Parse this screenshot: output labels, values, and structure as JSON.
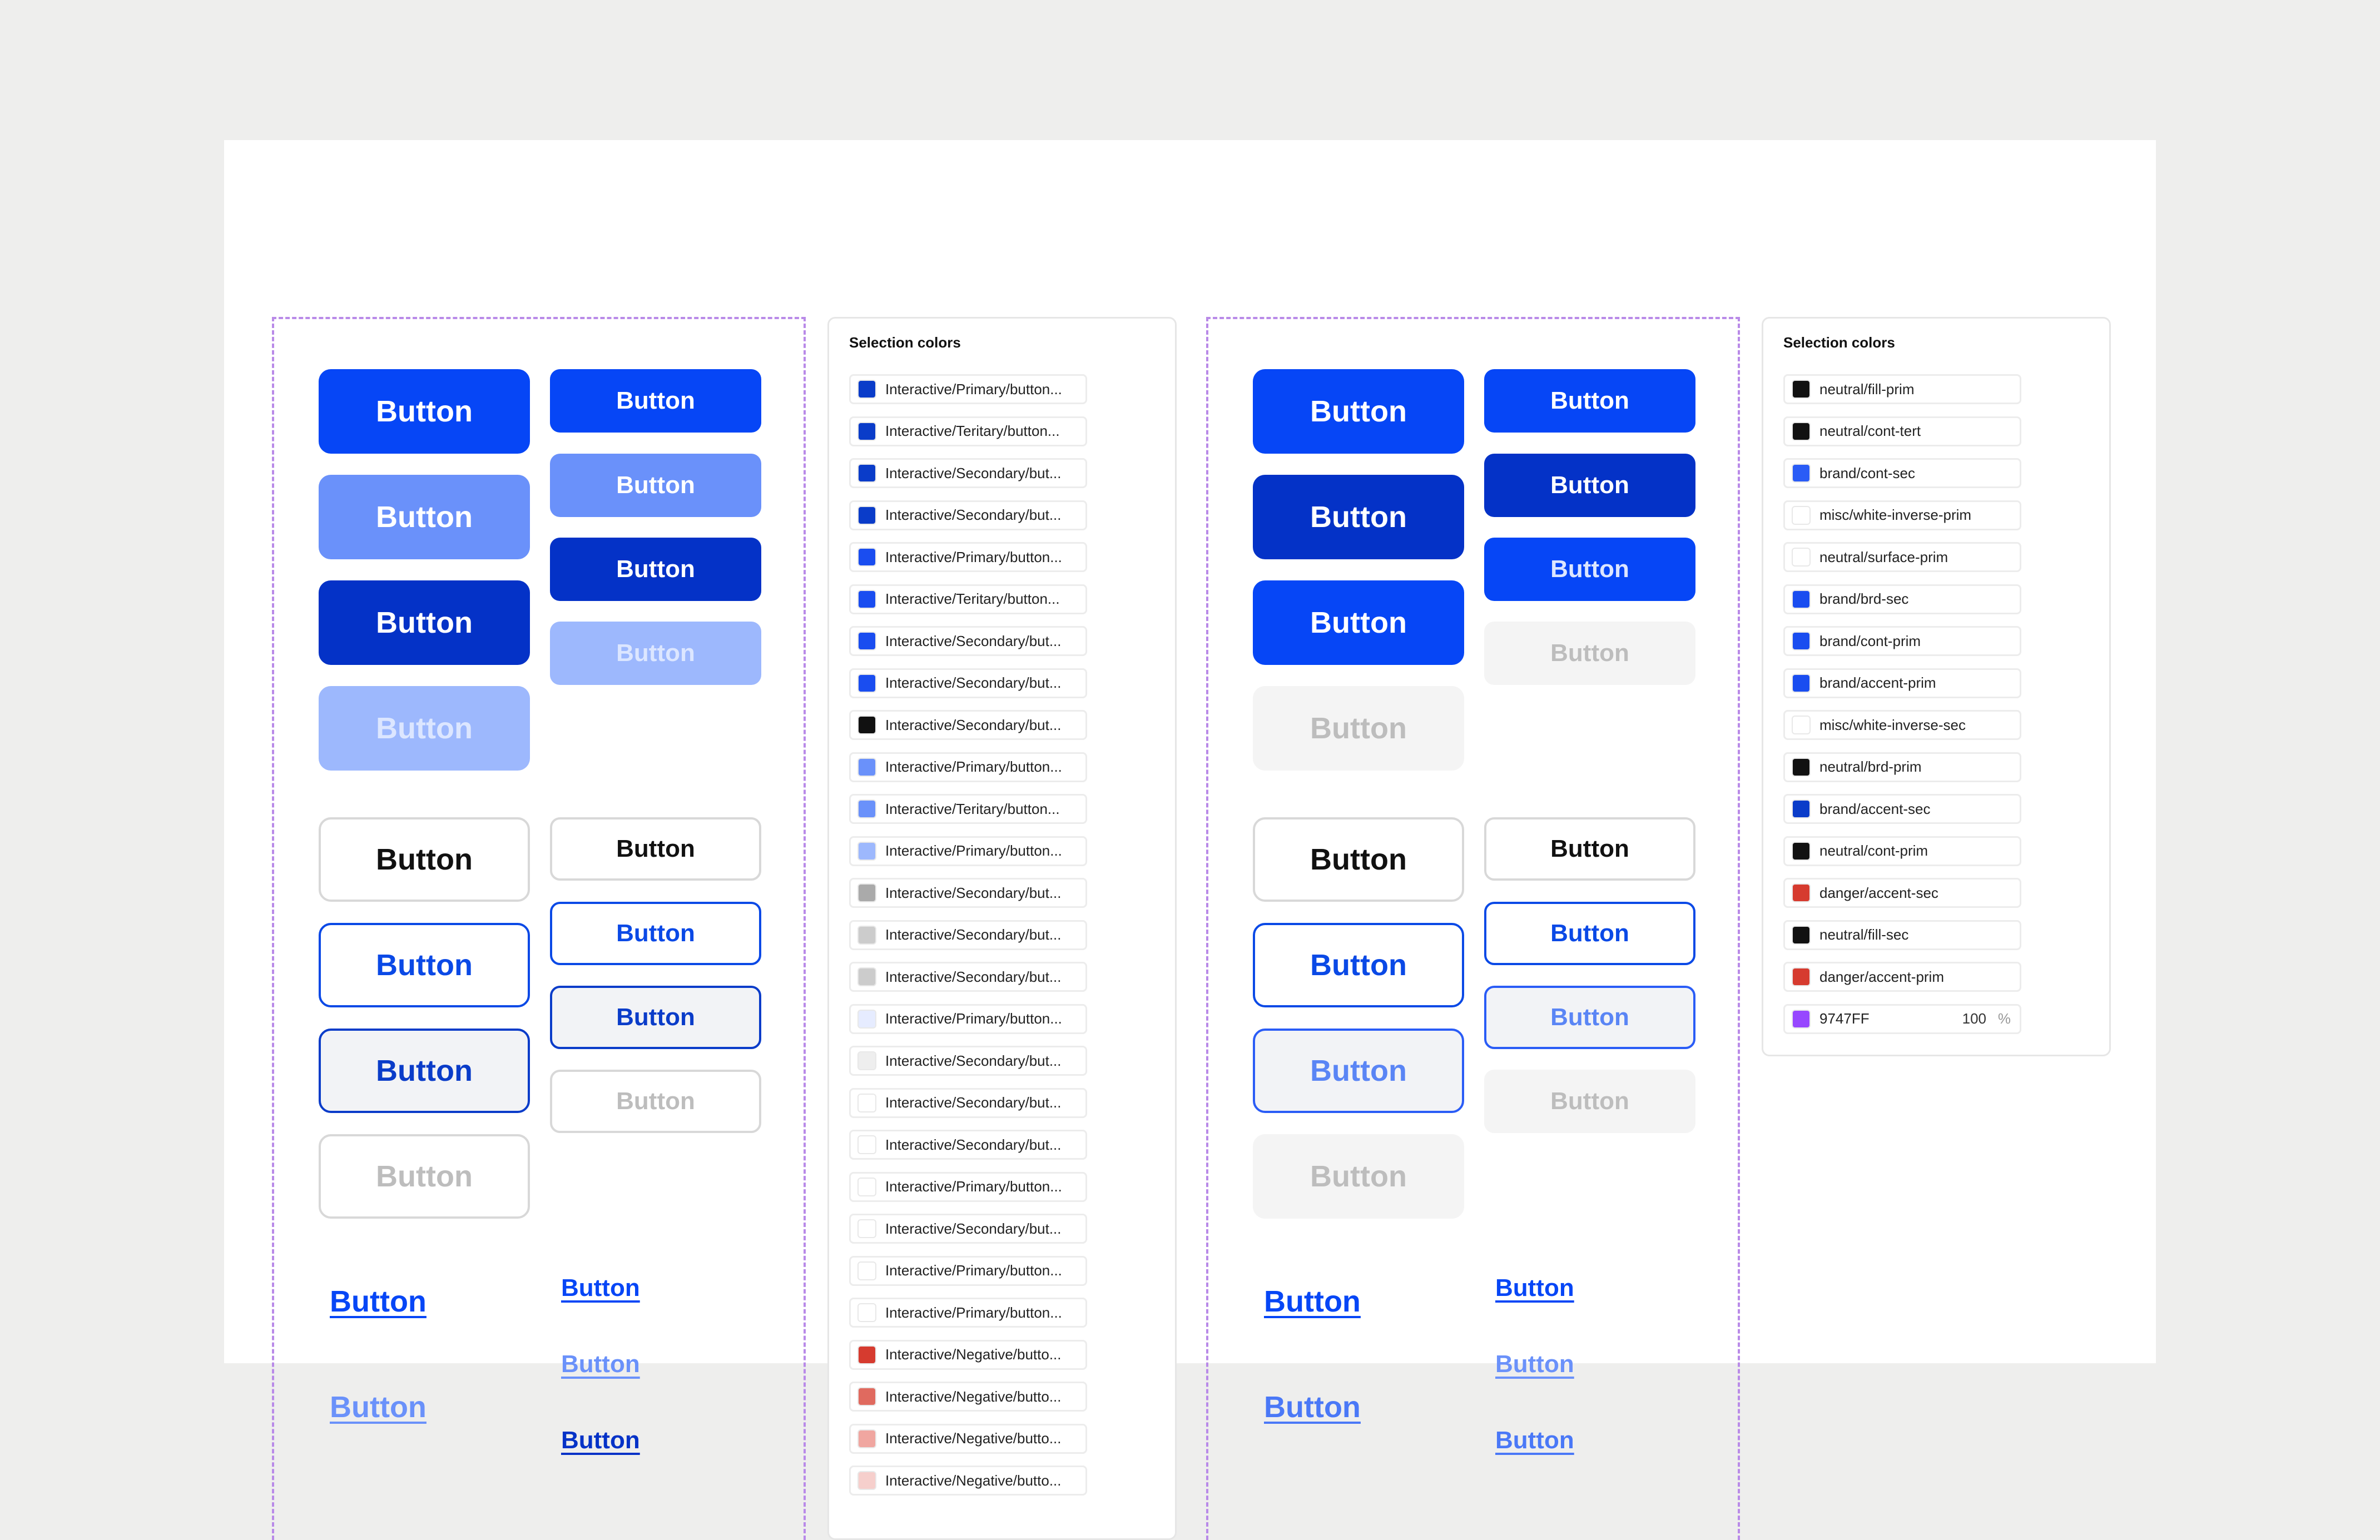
{
  "button_label": "Button",
  "selection_colors_title": "Selection colors",
  "colors": {
    "primary": "#0646f6",
    "light": "#6a91fa",
    "dark": "#0432c7",
    "faded": "#9db8fd",
    "white": "#ffffff",
    "outline_blue": "#0a49e6",
    "pale_fill": "#f2f3f6",
    "muted_fill": "#f4f4f4",
    "muted_text": "#bdbdbd",
    "dark_text": "#111111",
    "light_border": "#d8d8d8"
  },
  "left_panel": {
    "title": "Selection colors",
    "items": [
      {
        "label": "Interactive/Primary/button...",
        "color": "#0a3cc9"
      },
      {
        "label": "Interactive/Teritary/button...",
        "color": "#0a3cc9"
      },
      {
        "label": "Interactive/Secondary/but...",
        "color": "#0a3cc9"
      },
      {
        "label": "Interactive/Secondary/but...",
        "color": "#0a3cc9"
      },
      {
        "label": "Interactive/Primary/button...",
        "color": "#1a4df0"
      },
      {
        "label": "Interactive/Teritary/button...",
        "color": "#1a4df0"
      },
      {
        "label": "Interactive/Secondary/but...",
        "color": "#1a4df0"
      },
      {
        "label": "Interactive/Secondary/but...",
        "color": "#1a4df0"
      },
      {
        "label": "Interactive/Secondary/but...",
        "color": "#111111"
      },
      {
        "label": "Interactive/Primary/button...",
        "color": "#6a91fa"
      },
      {
        "label": "Interactive/Teritary/button...",
        "color": "#6a91fa"
      },
      {
        "label": "Interactive/Primary/button...",
        "color": "#9db8fd"
      },
      {
        "label": "Interactive/Secondary/but...",
        "color": "#aaaaaa"
      },
      {
        "label": "Interactive/Secondary/but...",
        "color": "#cccccc"
      },
      {
        "label": "Interactive/Secondary/but...",
        "color": "#cccccc"
      },
      {
        "label": "Interactive/Primary/button...",
        "color": "#e6ecff"
      },
      {
        "label": "Interactive/Secondary/but...",
        "color": "#eeeeee"
      },
      {
        "label": "Interactive/Secondary/but...",
        "color": "#ffffff"
      },
      {
        "label": "Interactive/Secondary/but...",
        "color": "#ffffff"
      },
      {
        "label": "Interactive/Primary/button...",
        "color": "#ffffff"
      },
      {
        "label": "Interactive/Secondary/but...",
        "color": "#ffffff"
      },
      {
        "label": "Interactive/Primary/button...",
        "color": "#ffffff"
      },
      {
        "label": "Interactive/Primary/button...",
        "color": "#ffffff"
      },
      {
        "label": "Interactive/Negative/butto...",
        "color": "#d63b2f"
      },
      {
        "label": "Interactive/Negative/butto...",
        "color": "#e06a5f"
      },
      {
        "label": "Interactive/Negative/butto...",
        "color": "#f0a6a0"
      },
      {
        "label": "Interactive/Negative/butto...",
        "color": "#f6cfcc"
      }
    ]
  },
  "right_panel": {
    "title": "Selection colors",
    "items": [
      {
        "label": "neutral/fill-prim",
        "color": "#111111"
      },
      {
        "label": "neutral/cont-tert",
        "color": "#111111"
      },
      {
        "label": "brand/cont-sec",
        "color": "#2a5cf6"
      },
      {
        "label": "misc/white-inverse-prim",
        "color": "#ffffff"
      },
      {
        "label": "neutral/surface-prim",
        "color": "#ffffff"
      },
      {
        "label": "brand/brd-sec",
        "color": "#1a4df0"
      },
      {
        "label": "brand/cont-prim",
        "color": "#1a4df0"
      },
      {
        "label": "brand/accent-prim",
        "color": "#1a4df0"
      },
      {
        "label": "misc/white-inverse-sec",
        "color": "#ffffff"
      },
      {
        "label": "neutral/brd-prim",
        "color": "#111111"
      },
      {
        "label": "brand/accent-sec",
        "color": "#0a3cc9"
      },
      {
        "label": "neutral/cont-prim",
        "color": "#111111"
      },
      {
        "label": "danger/accent-sec",
        "color": "#d63b2f"
      },
      {
        "label": "neutral/fill-sec",
        "color": "#111111"
      },
      {
        "label": "danger/accent-prim",
        "color": "#d63b2f"
      }
    ],
    "custom": {
      "label": "9747FF",
      "color": "#9747ff",
      "opacity": "100",
      "percent": "%"
    }
  }
}
